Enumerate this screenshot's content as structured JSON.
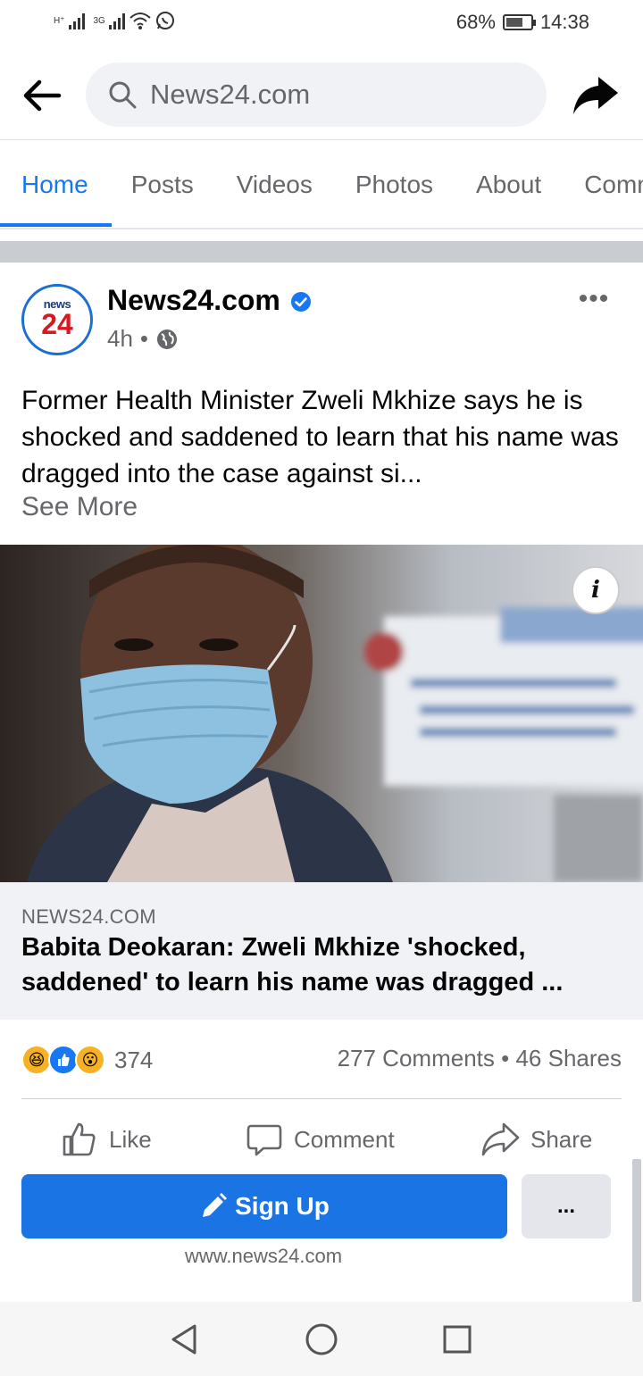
{
  "status_bar": {
    "network_1": "H⁺",
    "network_2": "3G",
    "battery_percent": "68%",
    "battery_level": 0.68,
    "time": "14:38",
    "icons": [
      "signal-icon",
      "wifi-icon",
      "whatsapp-icon",
      "battery-icon"
    ]
  },
  "top_bar": {
    "search_text": "News24.com",
    "icons": [
      "back-arrow-icon",
      "search-icon",
      "share-arrow-icon"
    ]
  },
  "tabs": [
    {
      "label": "Home",
      "active": true
    },
    {
      "label": "Posts",
      "active": false
    },
    {
      "label": "Videos",
      "active": false
    },
    {
      "label": "Photos",
      "active": false
    },
    {
      "label": "About",
      "active": false
    },
    {
      "label": "Comm",
      "active": false
    }
  ],
  "post": {
    "avatar_news": "news",
    "avatar_number": "24",
    "page_name": "News24.com",
    "time": "4h",
    "separator": "•",
    "text": "Former Health Minister Zweli Mkhize says he is shocked and saddened to learn that his name was dragged into the case against si...",
    "see_more": "See More",
    "info_label": "i",
    "link_domain": "NEWS24.COM",
    "link_title": "Babita Deokaran: Zweli Mkhize 'shocked, saddened' to learn his name was dragged ...",
    "reaction_count": "374",
    "reaction_icons": [
      "haha-reaction-icon",
      "like-reaction-icon",
      "wow-reaction-icon"
    ],
    "comments": "277 Comments",
    "shares": "46 Shares",
    "dot": "•",
    "like_label": "Like",
    "comment_label": "Comment",
    "share_label": "Share",
    "signup_label": "Sign Up",
    "more_label": "...",
    "website": "www.news24.com"
  },
  "colors": {
    "accent": "#1877f2",
    "signup_bg": "#1b74e4",
    "secondary_text": "#65676b",
    "logo_red": "#d71920"
  }
}
